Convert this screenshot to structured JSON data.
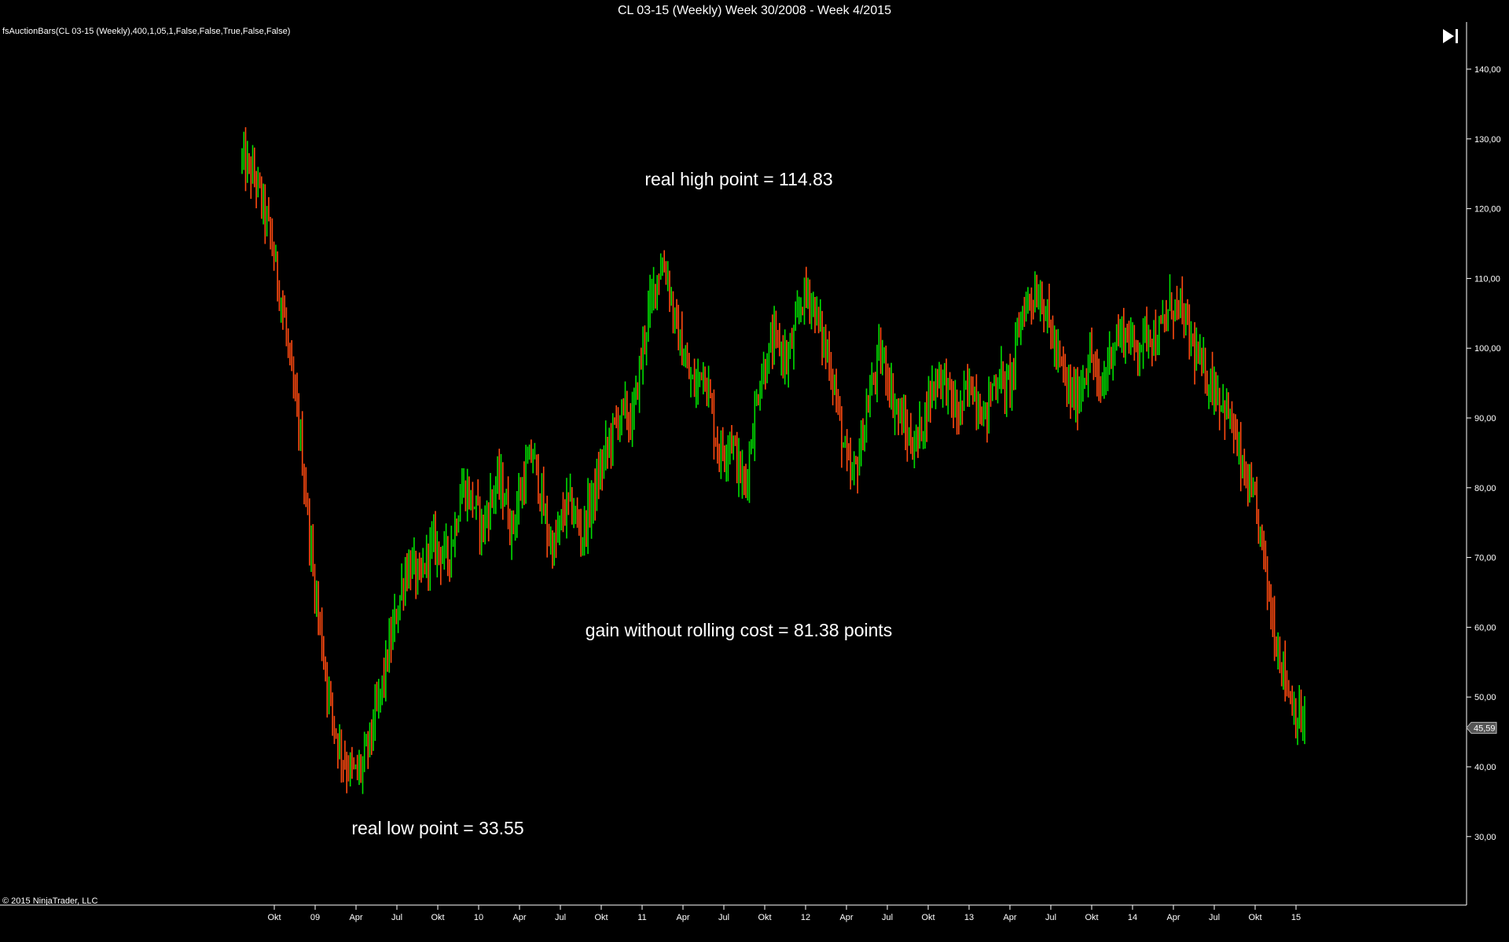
{
  "window": {
    "title": "CL 03-15 (Weekly)  Week 30/2008 - Week 4/2015"
  },
  "indicator_label": "fsAuctionBars(CL 03-15 (Weekly),400,1,05,1,False,False,True,False,False)",
  "copyright": "© 2015 NinjaTrader, LLC",
  "toolbar": {
    "scroll_end_icon": "skip-to-end-icon"
  },
  "colors": {
    "up": "#00e000",
    "down": "#ff4a10",
    "background": "#000000",
    "text": "#ffffff",
    "axis": "#ffffff"
  },
  "annotations": {
    "high": "real high point = 114.83",
    "gain": "gain without rolling cost = 81.38 points",
    "low": "real low point = 33.55"
  },
  "chart_data": {
    "type": "bar",
    "style": "ohlc-auction-bars",
    "title": "CL 03-15 (Weekly)  Week 30/2008 - Week 4/2015",
    "ylim": [
      20,
      145
    ],
    "y_ticks": [
      "140,00",
      "130,00",
      "120,00",
      "110,00",
      "100,00",
      "90,00",
      "80,00",
      "70,00",
      "60,00",
      "50,00",
      "40,00",
      "30,00"
    ],
    "x_ticks": [
      "Okt",
      "09",
      "Apr",
      "Jul",
      "Okt",
      "10",
      "Apr",
      "Jul",
      "Okt",
      "11",
      "Apr",
      "Jul",
      "Okt",
      "12",
      "Apr",
      "Jul",
      "Okt",
      "13",
      "Apr",
      "Jul",
      "Okt",
      "14",
      "Apr",
      "Jul",
      "Okt",
      "15"
    ],
    "last_price": "45,59",
    "price_path": [
      [
        0,
        127
      ],
      [
        4,
        124
      ],
      [
        8,
        116
      ],
      [
        12,
        104
      ],
      [
        14,
        95
      ],
      [
        16,
        89
      ],
      [
        18,
        79
      ],
      [
        20,
        68
      ],
      [
        22,
        60
      ],
      [
        24,
        52
      ],
      [
        26,
        46
      ],
      [
        28,
        42
      ],
      [
        30,
        40
      ],
      [
        32,
        39
      ],
      [
        34,
        40
      ],
      [
        36,
        44
      ],
      [
        38,
        48
      ],
      [
        40,
        53
      ],
      [
        42,
        58
      ],
      [
        44,
        63
      ],
      [
        46,
        68
      ],
      [
        48,
        69
      ],
      [
        50,
        66
      ],
      [
        52,
        70
      ],
      [
        54,
        72
      ],
      [
        56,
        71
      ],
      [
        58,
        70
      ],
      [
        60,
        74
      ],
      [
        62,
        80
      ],
      [
        64,
        79
      ],
      [
        66,
        77
      ],
      [
        68,
        74
      ],
      [
        70,
        78
      ],
      [
        72,
        81
      ],
      [
        74,
        79
      ],
      [
        76,
        74
      ],
      [
        78,
        78
      ],
      [
        80,
        82
      ],
      [
        82,
        85
      ],
      [
        84,
        80
      ],
      [
        86,
        74
      ],
      [
        88,
        71
      ],
      [
        90,
        75
      ],
      [
        92,
        78
      ],
      [
        94,
        76
      ],
      [
        96,
        73
      ],
      [
        98,
        77
      ],
      [
        100,
        80
      ],
      [
        102,
        84
      ],
      [
        104,
        87
      ],
      [
        106,
        90
      ],
      [
        108,
        91
      ],
      [
        110,
        89
      ],
      [
        112,
        96
      ],
      [
        114,
        103
      ],
      [
        116,
        108
      ],
      [
        118,
        112
      ],
      [
        120,
        111
      ],
      [
        122,
        104
      ],
      [
        124,
        100
      ],
      [
        126,
        96
      ],
      [
        128,
        94
      ],
      [
        130,
        98
      ],
      [
        132,
        93
      ],
      [
        134,
        86
      ],
      [
        136,
        85
      ],
      [
        138,
        88
      ],
      [
        140,
        83
      ],
      [
        142,
        80
      ],
      [
        144,
        88
      ],
      [
        146,
        95
      ],
      [
        148,
        98
      ],
      [
        150,
        101
      ],
      [
        152,
        100
      ],
      [
        154,
        98
      ],
      [
        156,
        102
      ],
      [
        158,
        107
      ],
      [
        160,
        108
      ],
      [
        162,
        105
      ],
      [
        164,
        101
      ],
      [
        166,
        98
      ],
      [
        168,
        92
      ],
      [
        170,
        85
      ],
      [
        172,
        81
      ],
      [
        174,
        84
      ],
      [
        176,
        90
      ],
      [
        178,
        95
      ],
      [
        180,
        99
      ],
      [
        182,
        97
      ],
      [
        184,
        92
      ],
      [
        186,
        90
      ],
      [
        188,
        87
      ],
      [
        190,
        86
      ],
      [
        192,
        89
      ],
      [
        194,
        93
      ],
      [
        196,
        96
      ],
      [
        198,
        96
      ],
      [
        200,
        93
      ],
      [
        202,
        90
      ],
      [
        204,
        93
      ],
      [
        206,
        95
      ],
      [
        208,
        92
      ],
      [
        210,
        90
      ],
      [
        212,
        95
      ],
      [
        214,
        96
      ],
      [
        216,
        94
      ],
      [
        218,
        98
      ],
      [
        220,
        105
      ],
      [
        222,
        107
      ],
      [
        224,
        108
      ],
      [
        226,
        107
      ],
      [
        228,
        103
      ],
      [
        230,
        99
      ],
      [
        232,
        96
      ],
      [
        234,
        93
      ],
      [
        236,
        93
      ],
      [
        238,
        97
      ],
      [
        240,
        99
      ],
      [
        242,
        93
      ],
      [
        244,
        97
      ],
      [
        246,
        101
      ],
      [
        248,
        102
      ],
      [
        250,
        102
      ],
      [
        252,
        100
      ],
      [
        254,
        101
      ],
      [
        256,
        103
      ],
      [
        258,
        101
      ],
      [
        260,
        103
      ],
      [
        262,
        106
      ],
      [
        264,
        106
      ],
      [
        266,
        104
      ],
      [
        268,
        101
      ],
      [
        270,
        98
      ],
      [
        272,
        96
      ],
      [
        274,
        95
      ],
      [
        276,
        93
      ],
      [
        278,
        91
      ],
      [
        280,
        88
      ],
      [
        282,
        83
      ],
      [
        284,
        80
      ],
      [
        286,
        77
      ],
      [
        288,
        72
      ],
      [
        290,
        64
      ],
      [
        292,
        58
      ],
      [
        294,
        54
      ],
      [
        296,
        50
      ],
      [
        298,
        47
      ],
      [
        300,
        46
      ]
    ]
  }
}
